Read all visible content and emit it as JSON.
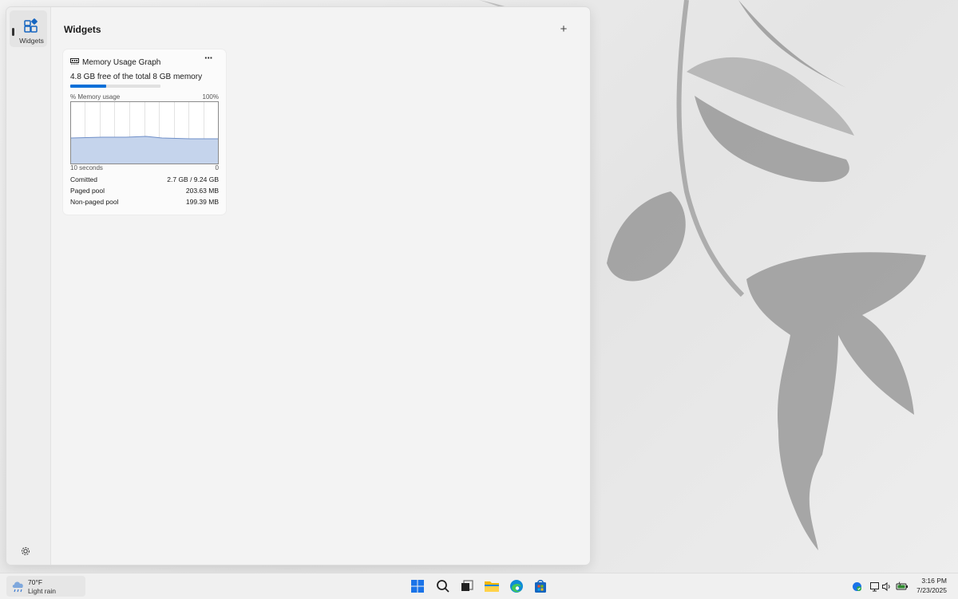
{
  "widgets_board": {
    "nav_label": "Widgets",
    "title": "Widgets",
    "add_label": "+",
    "card": {
      "title": "Memory Usage Graph",
      "more_label": "···",
      "summary": "4.8 GB free of the total 8 GB memory",
      "usage_fraction": 0.4,
      "graph": {
        "label_top_left": "% Memory usage",
        "label_top_right": "100%",
        "label_bottom_left": "10 seconds",
        "label_bottom_right": "0",
        "fill_color": "#c5d4ec",
        "line_color": "#6f8fc8"
      },
      "stats": [
        {
          "label": "Comitted",
          "value": "2.7 GB / 9.24 GB"
        },
        {
          "label": "Paged pool",
          "value": "203.63 MB"
        },
        {
          "label": "Non-paged pool",
          "value": "199.39 MB"
        }
      ]
    }
  },
  "taskbar": {
    "weather": {
      "temp": "70°F",
      "condition": "Light rain",
      "icon": "cloud-rain-icon"
    },
    "apps": [
      "windows-start-icon",
      "search-icon",
      "task-view-icon",
      "file-explorer-icon",
      "edge-icon",
      "store-icon"
    ],
    "tray": [
      "security-icon",
      "network-icon",
      "volume-icon",
      "battery-icon"
    ],
    "time": "3:16 PM",
    "date": "7/23/2025"
  },
  "colors": {
    "accent": "#0a6fd8"
  }
}
